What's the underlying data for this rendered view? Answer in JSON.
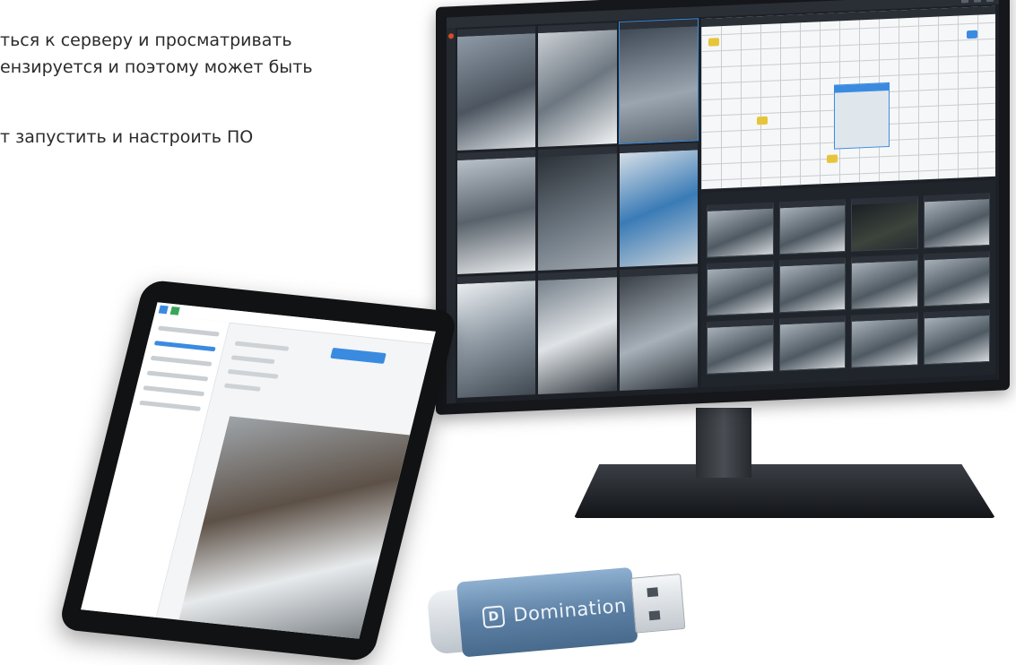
{
  "intro": {
    "line1": "ться к серверу и просматривать",
    "line2": "ензируется и поэтому может быть",
    "line3": "т запустить и настроить ПО"
  },
  "usb": {
    "logo_letter": "D",
    "brand": "Domination"
  },
  "colors": {
    "accent": "#3a8be0",
    "usb_body": "#5b7fa3",
    "monitor_frame": "#15171b"
  }
}
